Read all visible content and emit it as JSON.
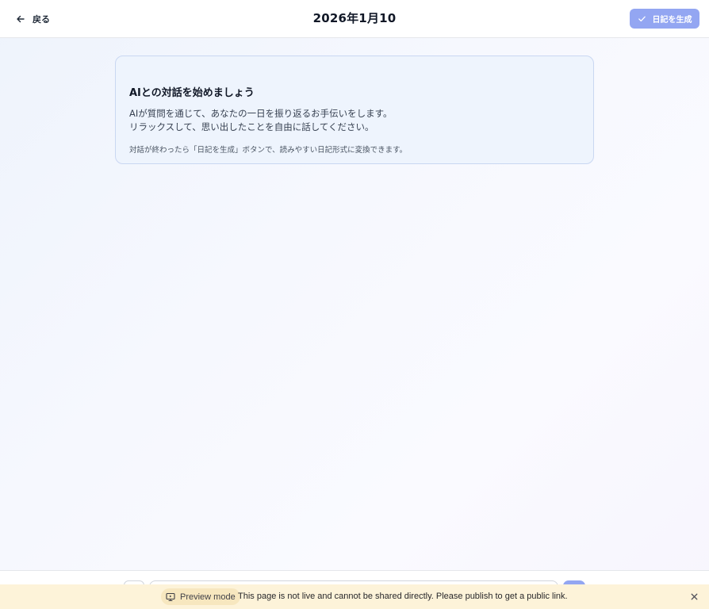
{
  "header": {
    "back_label": "戻る",
    "title": "2026年1月10",
    "generate_label": "日記を生成"
  },
  "intro": {
    "title": "AIとの対話を始めましょう",
    "body_line1": "AIが質問を通じて、あなたの一日を振り返るお手伝いをします。",
    "body_line2": "リラックスして、思い出したことを自由に話してください。",
    "note": "対話が終わったら「日記を生成」ボタンで、読みやすい日記形式に変換できます。"
  },
  "input": {
    "placeholder": ""
  },
  "preview_banner": {
    "mode_label": "Preview mode",
    "message": "This page is not live and cannot be shared directly. Please publish to get a public link."
  },
  "colors": {
    "accent": "#93a6f2",
    "card_bg": "#eef4fd",
    "card_border": "#c9d7f2",
    "banner_bg": "#fdf3d9"
  },
  "icons": {
    "back": "arrow-left-icon",
    "generate": "check-icon",
    "preview": "monitor-icon",
    "close": "close-icon"
  }
}
